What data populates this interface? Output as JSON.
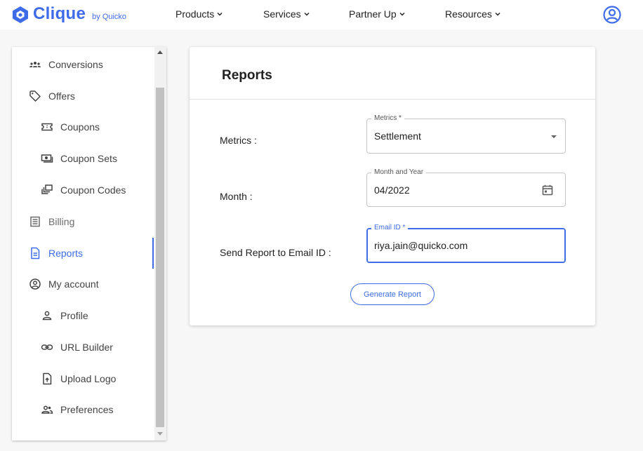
{
  "brand": {
    "name": "Clique",
    "byline": "by Quicko",
    "accent_color": "#3e6ce8"
  },
  "topnav": {
    "items": [
      {
        "label": "Products"
      },
      {
        "label": "Services"
      },
      {
        "label": "Partner Up"
      },
      {
        "label": "Resources"
      }
    ],
    "account_icon": "account-circle-icon"
  },
  "sidebar": {
    "items": [
      {
        "label": "Conversions",
        "icon": "people-group-icon"
      },
      {
        "label": "Offers",
        "icon": "tag-icon"
      },
      {
        "label": "Coupons",
        "icon": "ticket-icon"
      },
      {
        "label": "Coupon Sets",
        "icon": "banknote-icon"
      },
      {
        "label": "Coupon Codes",
        "icon": "stacked-cards-icon"
      },
      {
        "label": "Billing",
        "icon": "list-lines-icon"
      },
      {
        "label": "Reports",
        "icon": "document-icon"
      },
      {
        "label": "My account",
        "icon": "account-circle-icon"
      },
      {
        "label": "Profile",
        "icon": "person-icon"
      },
      {
        "label": "URL Builder",
        "icon": "link-icon"
      },
      {
        "label": "Upload Logo",
        "icon": "upload-file-icon"
      },
      {
        "label": "Preferences",
        "icon": "people-icon"
      }
    ],
    "active_item": "Reports"
  },
  "reports": {
    "title": "Reports",
    "metrics": {
      "label": "Metrics :",
      "floating_label": "Metrics *",
      "value": "Settlement"
    },
    "month": {
      "label": "Month :",
      "floating_label": "Month and Year",
      "value": "04/2022"
    },
    "email": {
      "label": "Send Report to Email ID :",
      "floating_label": "Email ID *",
      "value": "riya.jain@quicko.com"
    },
    "generate_button": "Generate Report"
  }
}
